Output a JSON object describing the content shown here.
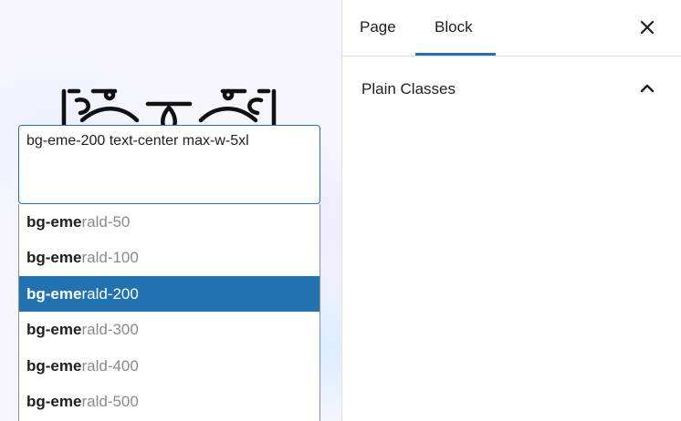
{
  "tabs": [
    {
      "label": "Page"
    },
    {
      "label": "Block"
    }
  ],
  "panel": {
    "title": "Plain Classes",
    "input_value": "bg-eme-200 text-center max-w-5xl"
  },
  "suggestions": [
    {
      "match": "bg-eme",
      "rest": "rald-50"
    },
    {
      "match": "bg-eme",
      "rest": "rald-100"
    },
    {
      "match": "bg-eme",
      "rest": "rald-200",
      "selected": true
    },
    {
      "match": "bg-eme",
      "rest": "rald-300"
    },
    {
      "match": "bg-eme",
      "rest": "rald-400"
    },
    {
      "match": "bg-eme",
      "rest": "rald-500"
    }
  ],
  "icons": {
    "close": "close-icon",
    "collapse": "chevron-up-icon",
    "logo": "gutenberg-logo"
  },
  "colors": {
    "accent": "#2271b1",
    "text": "#1e1e1e",
    "muted": "#8a8a8a"
  }
}
